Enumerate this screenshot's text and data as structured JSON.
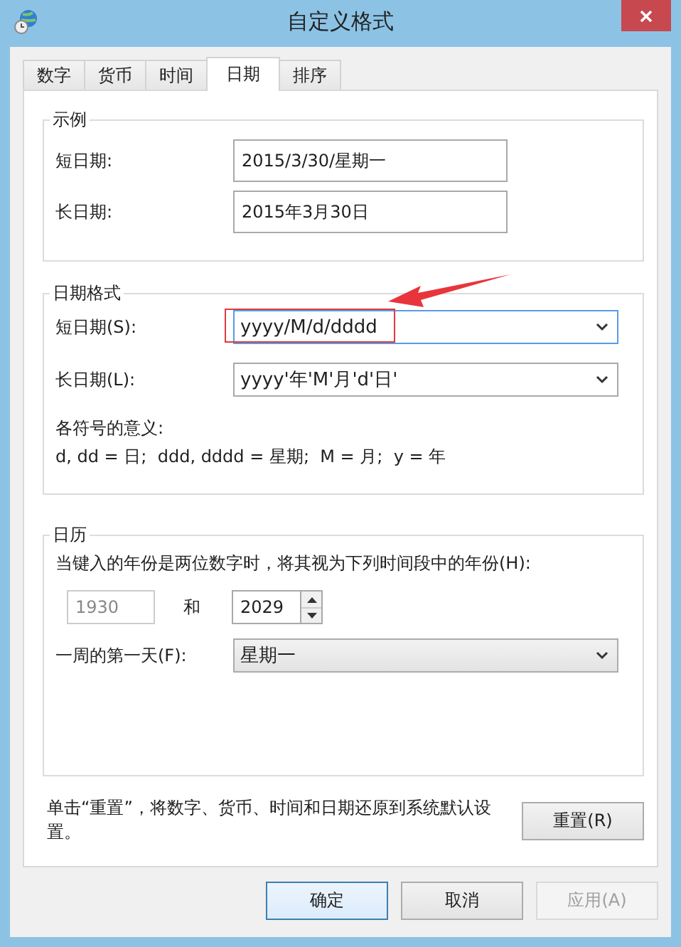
{
  "window": {
    "title": "自定义格式"
  },
  "tabs": [
    {
      "label": "数字",
      "selected": false
    },
    {
      "label": "货币",
      "selected": false
    },
    {
      "label": "时间",
      "selected": false
    },
    {
      "label": "日期",
      "selected": true
    },
    {
      "label": "排序",
      "selected": false
    }
  ],
  "sample": {
    "title": "示例",
    "rows": [
      {
        "label": "短日期:",
        "value": "2015/3/30/星期一"
      },
      {
        "label": "长日期:",
        "value": "2015年3月30日"
      }
    ]
  },
  "date_formats": {
    "title": "日期格式",
    "rows": [
      {
        "label": "短日期(S):",
        "value": "yyyy/M/d/dddd",
        "focused": true,
        "highlighted": true
      },
      {
        "label": "长日期(L):",
        "value": "yyyy'年'M'月'd'日'",
        "focused": false,
        "highlighted": false
      }
    ],
    "legend_title": "各符号的意义:",
    "legend": "d, dd = 日;  ddd, dddd = 星期;  M = 月;  y = 年"
  },
  "calendar": {
    "title": "日历",
    "prompt": "当键入的年份是两位数字时，将其视为下列时间段中的年份(H):",
    "from_year": {
      "value": "1930",
      "disabled": true
    },
    "and": "和",
    "to_year": {
      "value": "2029"
    },
    "first_day_label": "一周的第一天(F):",
    "first_day": "星期一"
  },
  "reset": {
    "text": "单击“重置”，将数字、货币、时间和日期还原到系统默认设置。",
    "button": "重置(R)"
  },
  "buttons": [
    {
      "label": "确定",
      "default": true,
      "disabled": false
    },
    {
      "label": "取消",
      "default": false,
      "disabled": false
    },
    {
      "label": "应用(A)",
      "default": false,
      "disabled": true
    }
  ]
}
